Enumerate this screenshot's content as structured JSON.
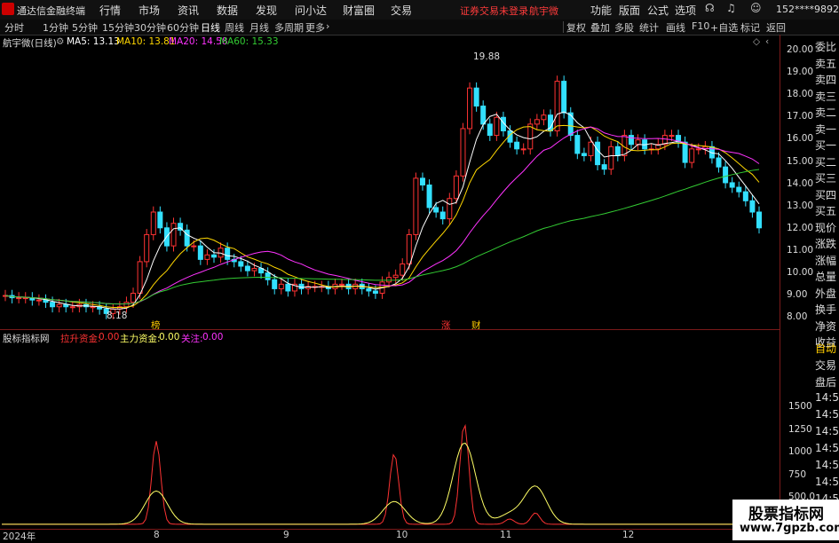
{
  "app": {
    "title": "通达信金融终端",
    "menu": [
      "行情",
      "市场",
      "资讯",
      "数据",
      "发现",
      "问小达",
      "财富圈",
      "交易"
    ],
    "warning": "证券交易未登录",
    "stock": "航宇微",
    "right_menu": [
      "功能",
      "版面",
      "公式",
      "选项"
    ],
    "account": "152****9892"
  },
  "periods": [
    "分时",
    "1分钟",
    "5分钟",
    "15分钟",
    "30分钟",
    "60分钟",
    "日线",
    "周线",
    "月线",
    "多周期",
    "更多"
  ],
  "toolbar": [
    "复权",
    "叠加",
    "多股",
    "统计",
    "画线",
    "F10",
    "+自选",
    "标记",
    "返回"
  ],
  "main": {
    "title": "航宇微(日线)",
    "ma": [
      {
        "label": "MA5: 13.13",
        "color": "#ffffff"
      },
      {
        "label": "MA10: 13.81",
        "color": "#ffd700"
      },
      {
        "label": "MA20: 14.58",
        "color": "#ff33ff"
      },
      {
        "label": "MA60: 15.33",
        "color": "#33cc33"
      }
    ],
    "high_label": "19.88",
    "low_label": "8.18",
    "markers": [
      {
        "text": "榜",
        "color": "#ffcc00"
      },
      {
        "text": "涨",
        "color": "#ff3333"
      },
      {
        "text": "财",
        "color": "#ffcc00"
      }
    ],
    "y_ticks": [
      "20.00",
      "19.00",
      "18.00",
      "17.00",
      "16.00",
      "15.00",
      "14.00",
      "13.00",
      "12.00",
      "11.00",
      "10.00",
      "9.00",
      "8.00"
    ]
  },
  "indicator": {
    "title": "股标指标网",
    "items": [
      {
        "label": "拉升资金:",
        "value": "0.00",
        "color": "#ff3333"
      },
      {
        "label": "主力资金:",
        "value": "0.00",
        "color": "#ffff66"
      },
      {
        "label": "关注:",
        "value": "0.00",
        "color": "#ff33ff"
      }
    ],
    "y_ticks": [
      "1500",
      "1250",
      "1000",
      "750",
      "500.0",
      "250.0"
    ]
  },
  "right_panel_top": [
    "委比",
    "卖五",
    "卖四",
    "卖三",
    "卖二",
    "卖一",
    "买一",
    "买二",
    "买三",
    "买四",
    "买五",
    "现价",
    "涨跌",
    "涨幅",
    "总量",
    "外盘",
    "换手",
    "净资",
    "收益"
  ],
  "right_panel_bottom": [
    "自动",
    "交易",
    "盘后",
    "14:56",
    "14:56",
    "14:56",
    "14:56",
    "14:56",
    "14:56",
    "14:56",
    "14:56"
  ],
  "x_ticks": [
    "2024年",
    "8",
    "9",
    "10",
    "11",
    "12"
  ],
  "watermark": {
    "line1": "股票指标网",
    "line2": "www.7gpzb.com"
  },
  "chart_data": [
    {
      "type": "candlestick",
      "ylim": [
        8,
        20
      ],
      "high": 19.88,
      "low": 8.18,
      "close": [
        9.1,
        9.0,
        9.0,
        9.0,
        8.9,
        8.9,
        8.8,
        8.6,
        8.7,
        8.6,
        8.6,
        8.7,
        8.6,
        8.6,
        8.5,
        8.3,
        8.5,
        8.6,
        8.8,
        9.2,
        10.6,
        11.8,
        12.8,
        12.1,
        11.3,
        12.3,
        12.0,
        11.3,
        11.3,
        10.7,
        10.9,
        10.8,
        11.2,
        10.7,
        10.6,
        10.4,
        10.2,
        10.3,
        10.1,
        9.8,
        9.4,
        9.6,
        9.3,
        9.6,
        9.4,
        9.5,
        9.5,
        9.5,
        9.4,
        9.6,
        9.6,
        9.4,
        9.6,
        9.4,
        9.3,
        9.2,
        9.7,
        9.9,
        10.0,
        10.5,
        11.8,
        14.3,
        14.0,
        13.0,
        12.8,
        12.5,
        13.4,
        14.4,
        16.5,
        18.3,
        17.5,
        16.7,
        16.2,
        17.0,
        16.4,
        15.9,
        15.6,
        15.6,
        16.7,
        16.9,
        17.1,
        16.4,
        18.6,
        17.2,
        16.2,
        15.4,
        15.3,
        15.9,
        14.9,
        14.7,
        15.7,
        15.3,
        16.2,
        15.8,
        16.0,
        15.6,
        15.6,
        15.8,
        16.2,
        16.2,
        15.9,
        15.0,
        15.6,
        15.6,
        15.7,
        15.2,
        14.8,
        14.1,
        13.9,
        13.7,
        13.3,
        12.8,
        12.1
      ]
    },
    {
      "type": "line",
      "series": [
        {
          "name": "拉升资金",
          "color": "#ff3333",
          "values": [
            0,
            0,
            0,
            0,
            0,
            0,
            0,
            0,
            0,
            0,
            0,
            0,
            0,
            0,
            0,
            0,
            0,
            0,
            0,
            0,
            0,
            0,
            0,
            0,
            0,
            0,
            0,
            0,
            0,
            0,
            0,
            0,
            0,
            0,
            0,
            0,
            0,
            0,
            0,
            0,
            0,
            0,
            0,
            0,
            0,
            0,
            0,
            0,
            0,
            0,
            0,
            0,
            0,
            0,
            0,
            0,
            0,
            0,
            0,
            0,
            0,
            0,
            0,
            0,
            0,
            0,
            0,
            0,
            0,
            0,
            0,
            0,
            0,
            0,
            0,
            0,
            0,
            0,
            0,
            0,
            0,
            0,
            0,
            0,
            0,
            0,
            0,
            0,
            0,
            0,
            0,
            0,
            0,
            0,
            0,
            0,
            0,
            0,
            0,
            0,
            0,
            0,
            0,
            0,
            0,
            0,
            0,
            0,
            0,
            0,
            0,
            0
          ]
        },
        {
          "name": "主力资金",
          "color": "#ffff66",
          "values": [
            0,
            0,
            0,
            0,
            0,
            0,
            0,
            0,
            0,
            0,
            0,
            0,
            0,
            0,
            0,
            0,
            0,
            0,
            0,
            0,
            0,
            0,
            0,
            0,
            0,
            0,
            0,
            0,
            0,
            0,
            0,
            0,
            0,
            0,
            0,
            0,
            0,
            0,
            0,
            0,
            0,
            0,
            0,
            0,
            0,
            0,
            0,
            0,
            0,
            0,
            0,
            0,
            0,
            0,
            0,
            0,
            0,
            0,
            0,
            0,
            0,
            0,
            0,
            0,
            0,
            0,
            0,
            0,
            0,
            0,
            0,
            0,
            0,
            0,
            0,
            0,
            0,
            0,
            0,
            0,
            0,
            0,
            0,
            0,
            0,
            0,
            0,
            0,
            0,
            0,
            0,
            0,
            0,
            0,
            0,
            0,
            0,
            0,
            0,
            0,
            0,
            0,
            0,
            0,
            0,
            0,
            0,
            0,
            0,
            0,
            0,
            0
          ]
        }
      ]
    }
  ]
}
